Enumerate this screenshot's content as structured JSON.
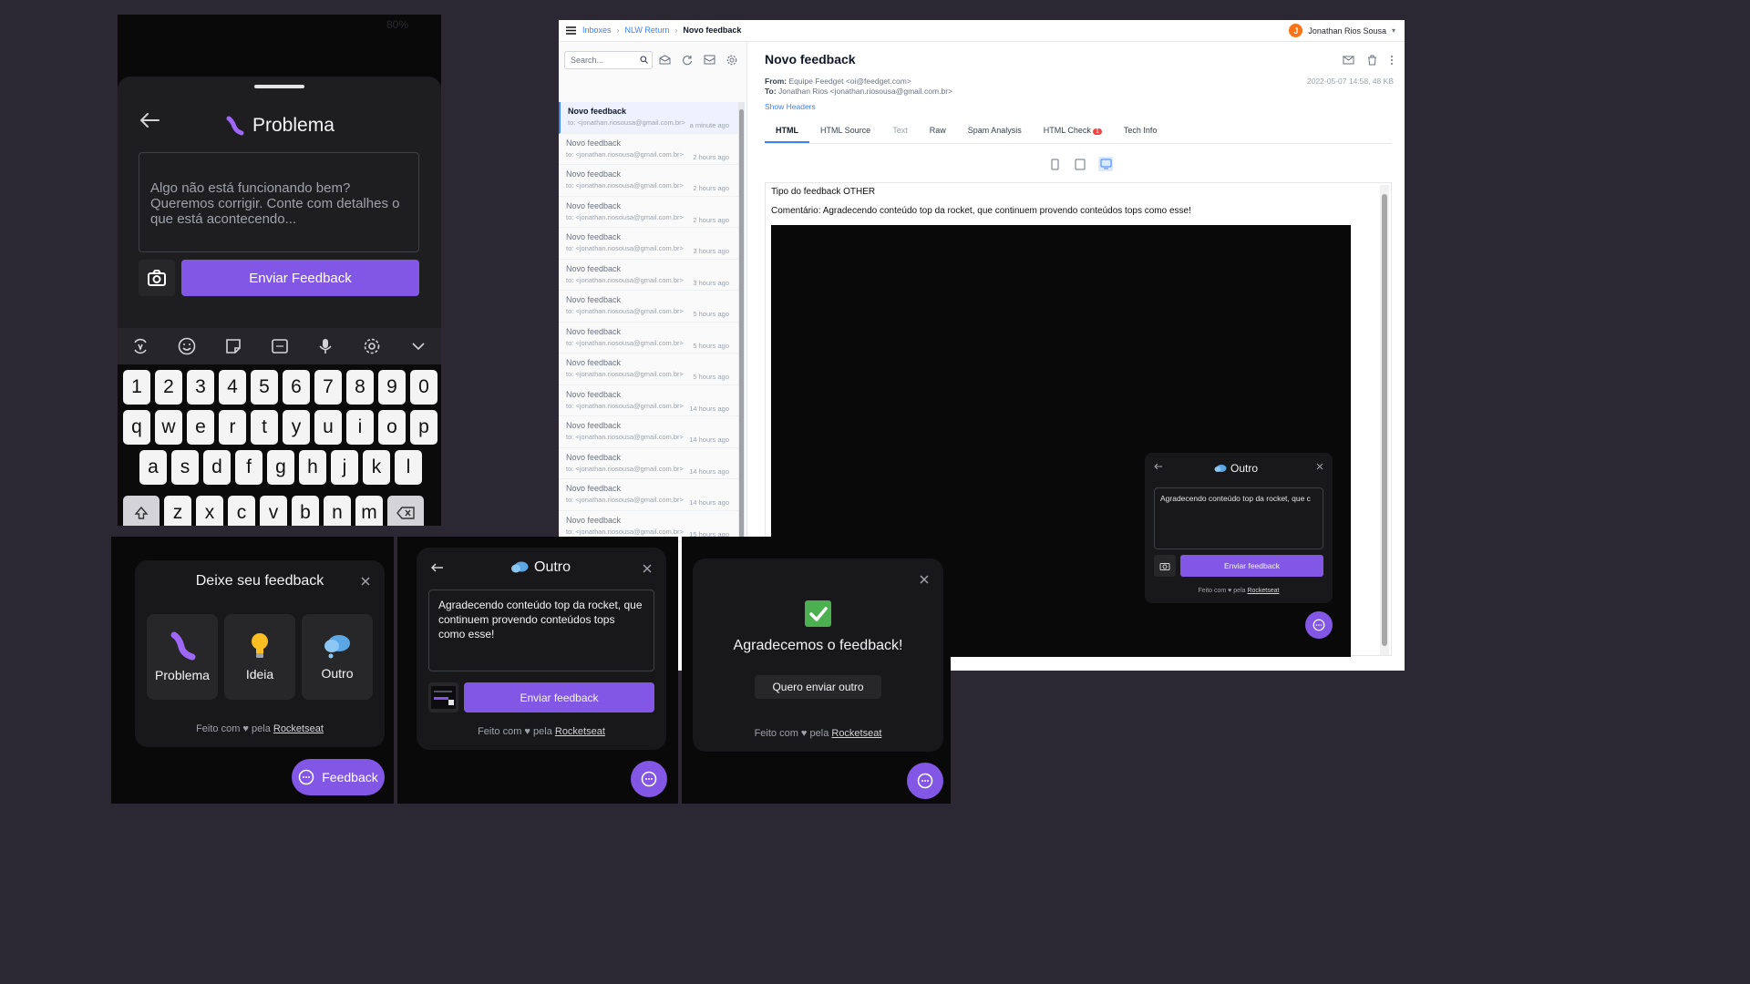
{
  "phone": {
    "status_right": "80%",
    "title": "Problema",
    "placeholder": "Algo não está funcionando bem? Queremos corrigir. Conte com detalhes o que está acontecendo...",
    "send_label": "Enviar Feedback",
    "keyboard": {
      "row1": [
        "1",
        "2",
        "3",
        "4",
        "5",
        "6",
        "7",
        "8",
        "9",
        "0"
      ],
      "row2": [
        "q",
        "w",
        "e",
        "r",
        "t",
        "y",
        "u",
        "i",
        "o",
        "p"
      ],
      "row3": [
        "a",
        "s",
        "d",
        "f",
        "g",
        "h",
        "j",
        "k",
        "l"
      ],
      "row4": [
        "z",
        "x",
        "c",
        "v",
        "b",
        "n",
        "m"
      ]
    }
  },
  "mail": {
    "breadcrumb": [
      "Inboxes",
      "NLW Return",
      "Novo feedback"
    ],
    "user_initial": "J",
    "user_name": "Jonathan Rios Sousa",
    "search_placeholder": "Search...",
    "messages": [
      {
        "subject": "Novo feedback",
        "to": "to: <jonathan.riosousa@gmail.com.br>",
        "time": "a minute ago"
      },
      {
        "subject": "Novo feedback",
        "to": "to: <jonathan.riosousa@gmail.com.br>",
        "time": "2 hours ago"
      },
      {
        "subject": "Novo feedback",
        "to": "to: <jonathan.riosousa@gmail.com.br>",
        "time": "2 hours ago"
      },
      {
        "subject": "Novo feedback",
        "to": "to: <jonathan.riosousa@gmail.com.br>",
        "time": "2 hours ago"
      },
      {
        "subject": "Novo feedback",
        "to": "to: <jonathan.riosousa@gmail.com.br>",
        "time": "3 hours ago"
      },
      {
        "subject": "Novo feedback",
        "to": "to: <jonathan.riosousa@gmail.com.br>",
        "time": "3 hours ago"
      },
      {
        "subject": "Novo feedback",
        "to": "to: <jonathan.riosousa@gmail.com.br>",
        "time": "5 hours ago"
      },
      {
        "subject": "Novo feedback",
        "to": "to: <jonathan.riosousa@gmail.com.br>",
        "time": "5 hours ago"
      },
      {
        "subject": "Novo feedback",
        "to": "to: <jonathan.riosousa@gmail.com.br>",
        "time": "5 hours ago"
      },
      {
        "subject": "Novo feedback",
        "to": "to: <jonathan.riosousa@gmail.com.br>",
        "time": "14 hours ago"
      },
      {
        "subject": "Novo feedback",
        "to": "to: <jonathan.riosousa@gmail.com.br>",
        "time": "14 hours ago"
      },
      {
        "subject": "Novo feedback",
        "to": "to: <jonathan.riosousa@gmail.com.br>",
        "time": "14 hours ago"
      },
      {
        "subject": "Novo feedback",
        "to": "to: <jonathan.riosousa@gmail.com.br>",
        "time": "14 hours ago"
      },
      {
        "subject": "Novo feedback",
        "to": "to: <jonathan.riosousa@gmail.com.br>",
        "time": "15 hours ago"
      }
    ],
    "subject": "Novo feedback",
    "from_label": "From:",
    "from_value": "Equipe Feedget <oi@feedget.com>",
    "to_label": "To:",
    "to_value": "Jonathan Rios <jonathan.riosousa@gmail.com.br>",
    "date": "2022-05-07 14:58, 48 KB",
    "show_headers": "Show Headers",
    "tabs": [
      "HTML",
      "HTML Source",
      "Text",
      "Raw",
      "Spam Analysis",
      "HTML Check",
      "Tech Info"
    ],
    "html_check_badge": "1",
    "body_line1": "Tipo do feedback OTHER",
    "body_line2": "Comentário: Agradecendo conteúdo top da rocket, que continuem provendo conteúdos tops como esse!",
    "mini": {
      "title": "Outro",
      "text": "Agradecendo conteúdo top da rocket, que c",
      "send": "Enviar feedback",
      "foot_prefix": "Feito com ♥ pela",
      "foot_link": "Rocketseat"
    }
  },
  "panel1": {
    "title": "Deixe seu feedback",
    "options": [
      "Problema",
      "Ideia",
      "Outro"
    ],
    "foot_prefix": "Feito com ♥ pela",
    "foot_link": "Rocketseat",
    "fab_label": "Feedback"
  },
  "panel2": {
    "title": "Outro",
    "text": "Agradecendo conteúdo top da rocket, que continuem provendo conteúdos tops como esse!",
    "send": "Enviar feedback",
    "foot_prefix": "Feito com ♥ pela",
    "foot_link": "Rocketseat"
  },
  "panel3": {
    "title": "Agradecemos o feedback!",
    "again": "Quero enviar outro",
    "foot_prefix": "Feito com ♥ pela",
    "foot_link": "Rocketseat"
  },
  "colors": {
    "brand": "#8257e5",
    "panel": "#18181b",
    "background": "#2b2833",
    "link": "#3b82f6"
  }
}
